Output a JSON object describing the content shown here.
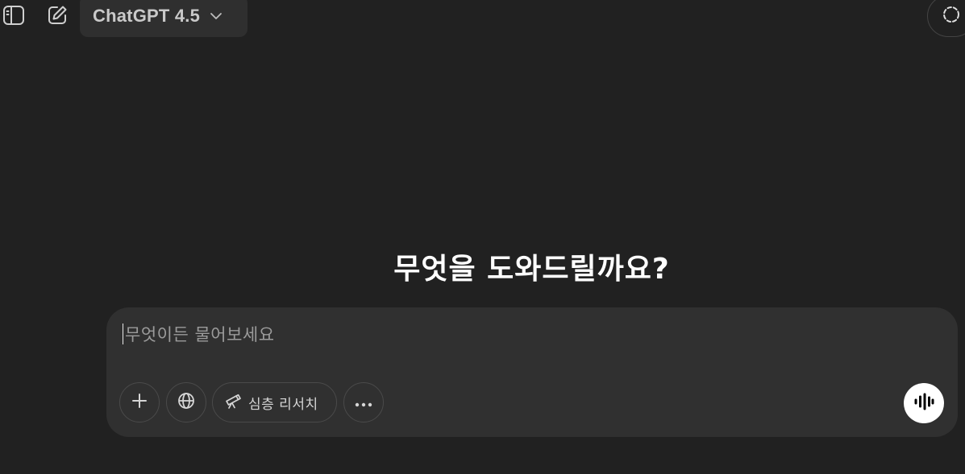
{
  "header": {
    "sidebar_toggle_icon": "sidebar-icon",
    "new_chat_icon": "edit-icon",
    "model_selector": {
      "label": "ChatGPT 4.5",
      "icon": "chevron-down-icon"
    },
    "temporary_chat_icon": "dashed-circle-icon"
  },
  "main": {
    "heading": "무엇을 도와드릴까요?"
  },
  "composer": {
    "placeholder": "무엇이든 물어보세요",
    "value": "",
    "buttons": {
      "add_icon": "plus-icon",
      "search_icon": "globe-icon",
      "deep_research": {
        "icon": "telescope-icon",
        "label": "심층 리서치"
      },
      "more_icon": "more-horizontal-icon",
      "voice_icon": "voice-wave-icon"
    }
  },
  "colors": {
    "background": "#212121",
    "composer_background": "#303030",
    "model_selector_background": "#2f2f2f",
    "placeholder_text": "#9b9b9b",
    "heading_text": "#ffffff",
    "voice_button": "#ffffff"
  }
}
